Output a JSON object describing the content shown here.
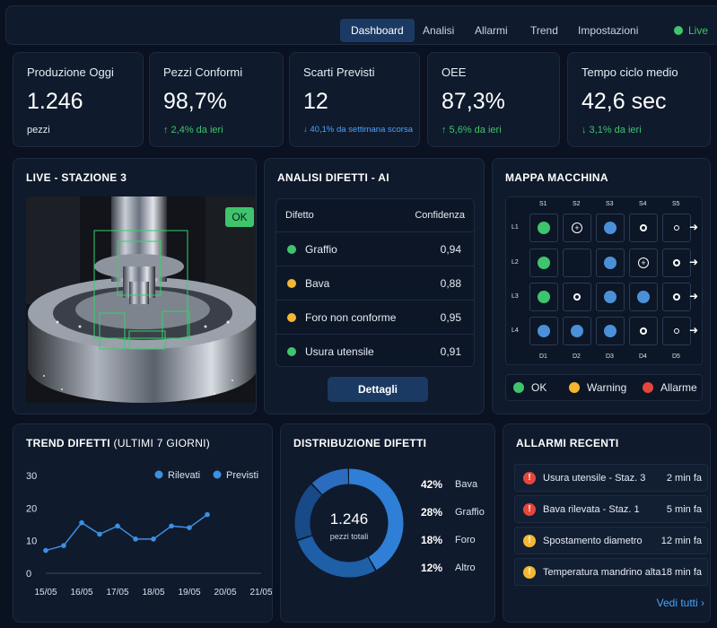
{
  "nav": {
    "items": [
      "Dashboard",
      "Analisi",
      "Allarmi",
      "Trend",
      "Impostazioni"
    ],
    "active": "Dashboard",
    "live_label": "Live"
  },
  "kpis": [
    {
      "title": "Produzione Oggi",
      "value": "1.246",
      "sub": "pezzi"
    },
    {
      "title": "Pezzi Conformi",
      "value": "98,7%",
      "sub": "↑ 2,4% da ieri"
    },
    {
      "title": "Scarti Previsti",
      "value": "12",
      "sub": "↓ 40,1% da settimana scorsa"
    },
    {
      "title": "OEE",
      "value": "87,3%",
      "sub": "↑ 5,6% da ieri"
    },
    {
      "title": "Tempo ciclo medio",
      "value": "42,6 sec",
      "sub": "↓ 3,1% da ieri"
    }
  ],
  "live": {
    "title": "LIVE - STAZIONE 3",
    "badge": "OK"
  },
  "defects": {
    "title": "ANALISI DIFETTI - AI",
    "col_defect": "Difetto",
    "col_conf": "Confidenza",
    "rows": [
      {
        "name": "Graffio",
        "conf": "0,94",
        "color": "#3ec46d"
      },
      {
        "name": "Bava",
        "conf": "0,88",
        "color": "#f5b731"
      },
      {
        "name": "Foro non conforme",
        "conf": "0,95",
        "color": "#f5b731"
      },
      {
        "name": "Usura utensile",
        "conf": "0,91",
        "color": "#3ec46d"
      }
    ],
    "button": "Dettagli"
  },
  "map": {
    "title": "MAPPA MACCHINA",
    "cols": [
      "S1",
      "S2",
      "S3",
      "S4",
      "S5"
    ],
    "rows": [
      "L1",
      "L2",
      "L3",
      "L4"
    ],
    "bottom": [
      "D1",
      "D2",
      "D3",
      "D4",
      "D5"
    ],
    "legend": [
      {
        "label": "OK",
        "color": "#3ec46d"
      },
      {
        "label": "Warning",
        "color": "#f5b731"
      },
      {
        "label": "Allarme",
        "color": "#e5463c"
      }
    ]
  },
  "trend": {
    "title": "TREND DIFETTI",
    "title_suffix": "(ULTIMI 7 GIORNI)",
    "legend": [
      "Rilevati",
      "Previsti"
    ]
  },
  "chart_data": {
    "type": "line",
    "categories": [
      "15/05",
      "16/05",
      "17/05",
      "18/05",
      "19/05",
      "20/05",
      "21/05"
    ],
    "x": [
      0,
      0.5,
      1,
      1.5,
      2,
      2.5,
      3,
      3.5,
      4,
      4.5,
      5,
      5.5,
      6
    ],
    "series": [
      {
        "name": "Rilevati",
        "values": [
          7,
          8.5,
          15.5,
          12,
          14.5,
          10.5,
          10.5,
          14.5,
          14,
          18
        ]
      }
    ],
    "ylim": [
      0,
      30
    ],
    "yticks": [
      0,
      10,
      20,
      30
    ],
    "grid": false,
    "legend": "top-right"
  },
  "distribution": {
    "title": "DISTRIBUZIONE DIFETTI",
    "center_value": "1.246",
    "center_label": "pezzi totali",
    "items": [
      {
        "pct": "42%",
        "label": "Bava",
        "value": 42,
        "color": "#2f7fd6"
      },
      {
        "pct": "28%",
        "label": "Graffio",
        "value": 28,
        "color": "#1f5fa8"
      },
      {
        "pct": "18%",
        "label": "Foro",
        "value": 18,
        "color": "#174a86"
      },
      {
        "pct": "12%",
        "label": "Altro",
        "value": 12,
        "color": "#2b6cc0"
      }
    ]
  },
  "alarms": {
    "title": "ALLARMI RECENTI",
    "items": [
      {
        "text": "Usura utensile - Staz. 3",
        "time": "2 min fa",
        "level": "alarm",
        "color": "#e5463c"
      },
      {
        "text": "Bava rilevata - Staz. 1",
        "time": "5 min fa",
        "level": "alarm",
        "color": "#e5463c"
      },
      {
        "text": "Spostamento diametro",
        "time": "12 min fa",
        "level": "warning",
        "color": "#f5b731"
      },
      {
        "text": "Temperatura mandrino alta",
        "time": "18 min fa",
        "level": "warning",
        "color": "#f5b731"
      }
    ],
    "see_all": "Vedi tutti ›"
  }
}
